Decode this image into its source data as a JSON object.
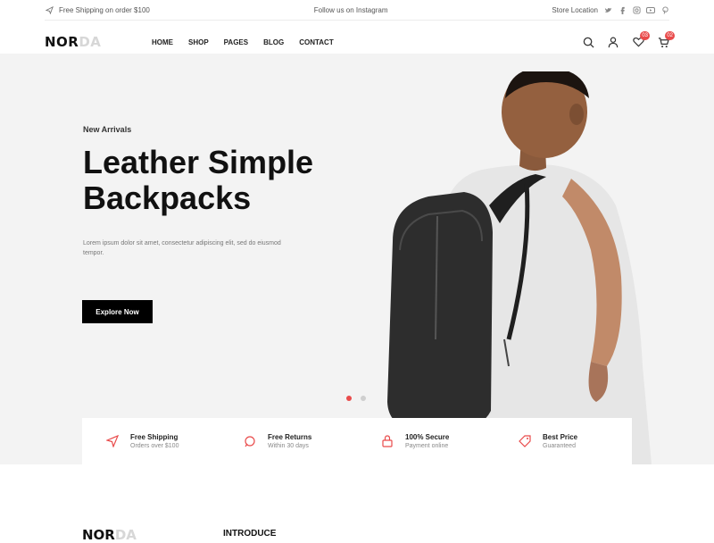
{
  "topbar": {
    "left_text": "Free Shipping on order $100",
    "center_text": "Follow us on Instagram",
    "right_text": "Store Location",
    "social_icons": [
      "twitter-icon",
      "facebook-icon",
      "instagram-icon",
      "youtube-icon",
      "pinterest-icon"
    ]
  },
  "header": {
    "logo_main": "NOR",
    "logo_accent": "DA",
    "nav": [
      "HOME",
      "SHOP",
      "PAGES",
      "BLOG",
      "CONTACT"
    ],
    "wishlist_count": "03",
    "cart_count": "02"
  },
  "hero": {
    "tag": "New Arrivals",
    "title_line1": "Leather Simple",
    "title_line2": "Backpacks",
    "description": "Lorem ipsum dolor sit amet, consectetur adipiscing elit, sed do eiusmod tempor.",
    "button_label": "Explore Now"
  },
  "features": [
    {
      "icon": "send-icon",
      "title": "Free Shipping",
      "subtitle": "Orders over $100"
    },
    {
      "icon": "support-icon",
      "title": "Free Returns",
      "subtitle": "Within 30 days"
    },
    {
      "icon": "lock-icon",
      "title": "100% Secure",
      "subtitle": "Payment online"
    },
    {
      "icon": "tag-icon",
      "title": "Best Price",
      "subtitle": "Guaranteed"
    }
  ],
  "bottom": {
    "logo_main": "NOR",
    "logo_accent": "DA",
    "heading": "INTRODUCE"
  },
  "colors": {
    "accent": "#e94b4b",
    "hero_bg": "#f3f3f3",
    "button_bg": "#000000"
  }
}
